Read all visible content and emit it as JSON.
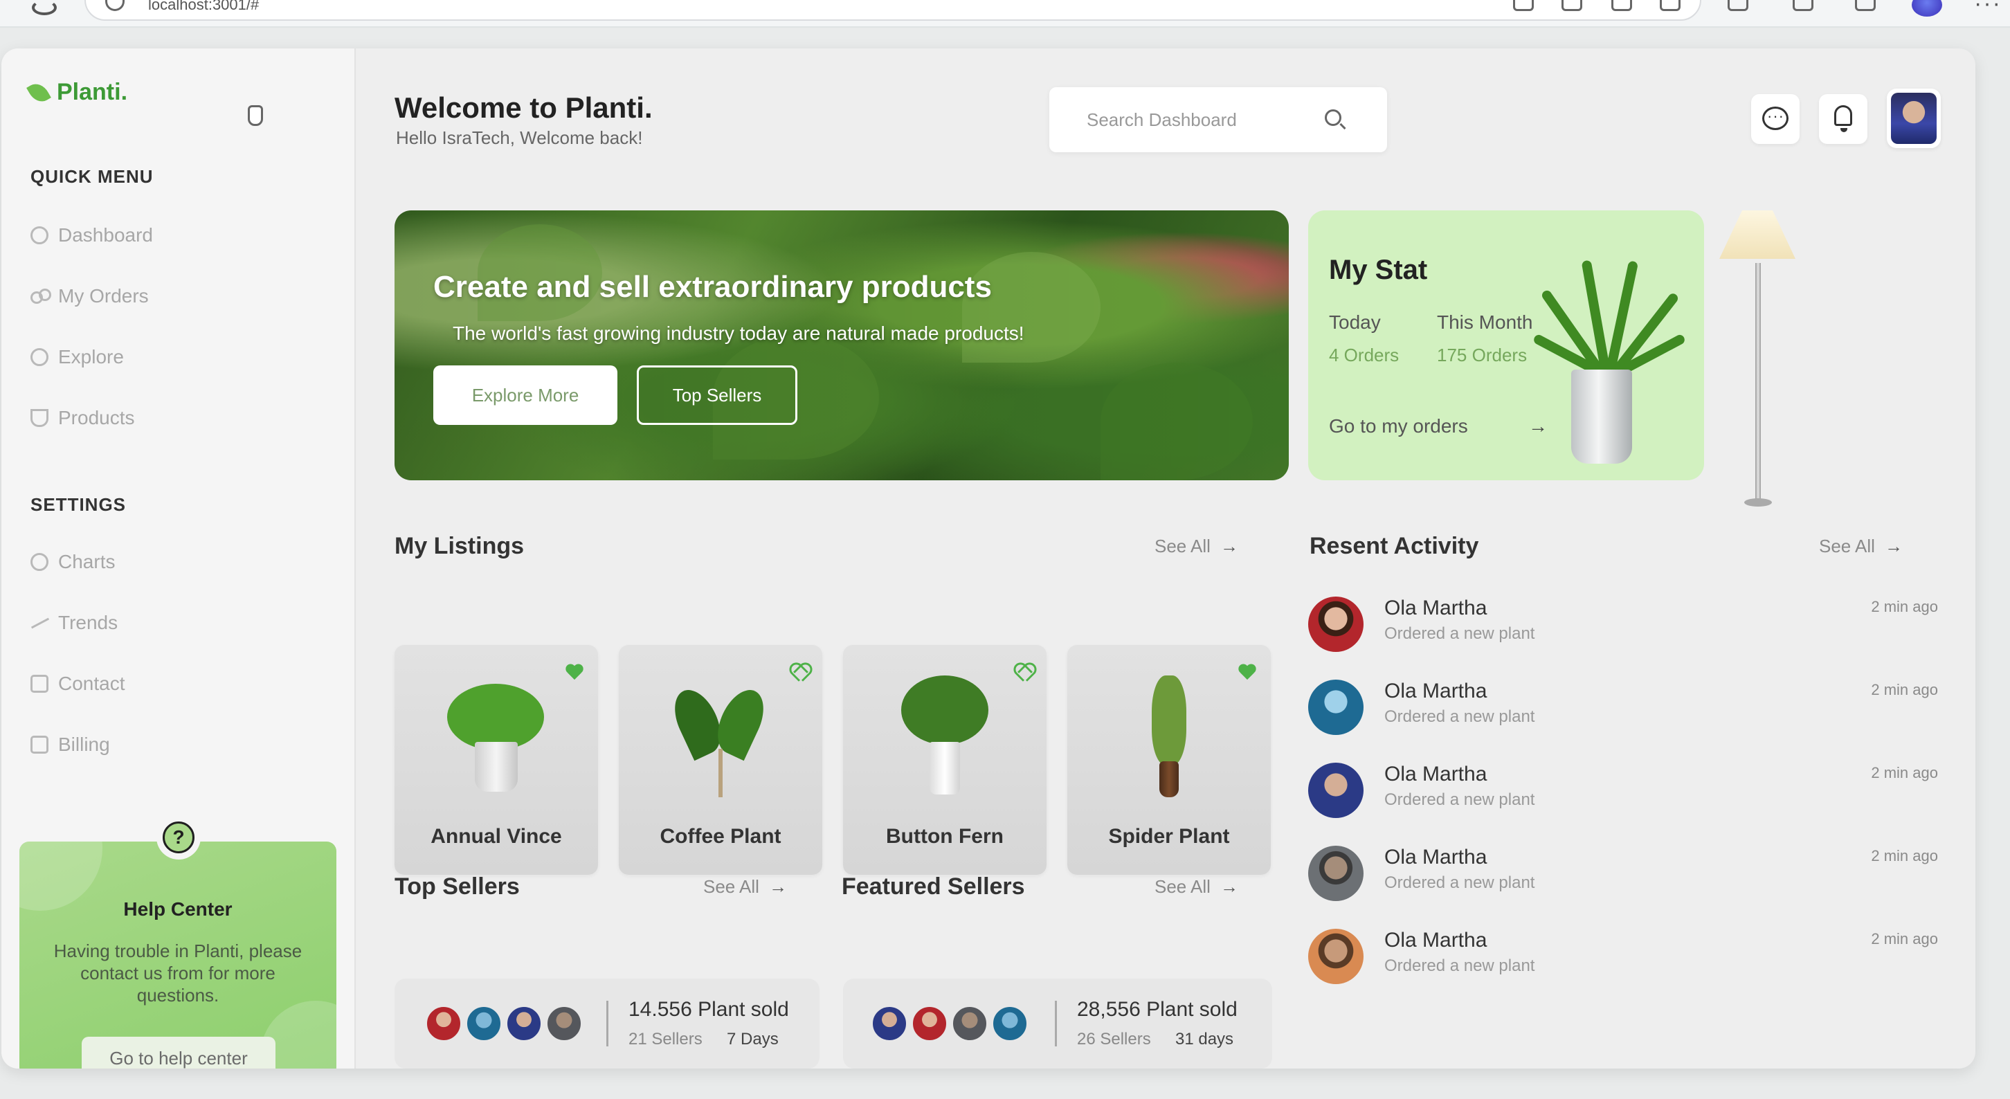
{
  "browser": {
    "url": "localhost:3001/#"
  },
  "brand": {
    "name": "Planti."
  },
  "sidebar": {
    "quick_menu_heading": "QUICK MENU",
    "quick_menu": [
      {
        "label": "Dashboard",
        "icon": "dashboard-icon"
      },
      {
        "label": "My Orders",
        "icon": "orders-icon"
      },
      {
        "label": "Explore",
        "icon": "compass-icon"
      },
      {
        "label": "Products",
        "icon": "trophy-icon"
      }
    ],
    "settings_heading": "SETTINGS",
    "settings": [
      {
        "label": "Charts",
        "icon": "pie-chart-icon"
      },
      {
        "label": "Trends",
        "icon": "trend-line-icon"
      },
      {
        "label": "Contact",
        "icon": "contact-icon"
      },
      {
        "label": "Billing",
        "icon": "billing-icon"
      }
    ],
    "help": {
      "title": "Help Center",
      "description": "Having trouble in Planti, please contact us from for more questions.",
      "button": "Go to help center"
    }
  },
  "header": {
    "title": "Welcome to Planti.",
    "subtitle": "Hello IsraTech, Welcome back!",
    "search_placeholder": "Search Dashboard"
  },
  "hero": {
    "title": "Create and sell extraordinary products",
    "subtitle": "The world's fast growing industry today are natural made products!",
    "primary_button": "Explore More",
    "secondary_button": "Top Sellers"
  },
  "stat": {
    "title": "My Stat",
    "today_label": "Today",
    "today_value": "4 Orders",
    "month_label": "This Month",
    "month_value": "175 Orders",
    "link": "Go to my orders",
    "link_arrow": "→"
  },
  "listings": {
    "title": "My Listings",
    "see_all": "See All",
    "items": [
      {
        "name": "Annual Vince",
        "favorite": true
      },
      {
        "name": "Coffee Plant",
        "favorite": false
      },
      {
        "name": "Button Fern",
        "favorite": false
      },
      {
        "name": "Spider Plant",
        "favorite": true
      }
    ]
  },
  "top_sellers": {
    "title": "Top Sellers",
    "see_all": "See All",
    "sold": "14.556 Plant sold",
    "sellers": "21 Sellers",
    "days": "7 Days"
  },
  "featured_sellers": {
    "title": "Featured Sellers",
    "see_all": "See All",
    "sold": "28,556 Plant sold",
    "sellers": "26 Sellers",
    "days": "31 days"
  },
  "activity": {
    "title": "Resent Activity",
    "see_all": "See All",
    "items": [
      {
        "name": "Ola Martha",
        "action": "Ordered a new plant",
        "time": "2 min ago"
      },
      {
        "name": "Ola Martha",
        "action": "Ordered a new plant",
        "time": "2 min ago"
      },
      {
        "name": "Ola Martha",
        "action": "Ordered a new plant",
        "time": "2 min ago"
      },
      {
        "name": "Ola Martha",
        "action": "Ordered a new plant",
        "time": "2 min ago"
      },
      {
        "name": "Ola Martha",
        "action": "Ordered a new plant",
        "time": "2 min ago"
      }
    ]
  },
  "colors": {
    "accent_green": "#4eb248",
    "brand_green": "#3d9a36",
    "stat_bg": "#d2f1c0",
    "help_bg": "#a9d98a"
  }
}
